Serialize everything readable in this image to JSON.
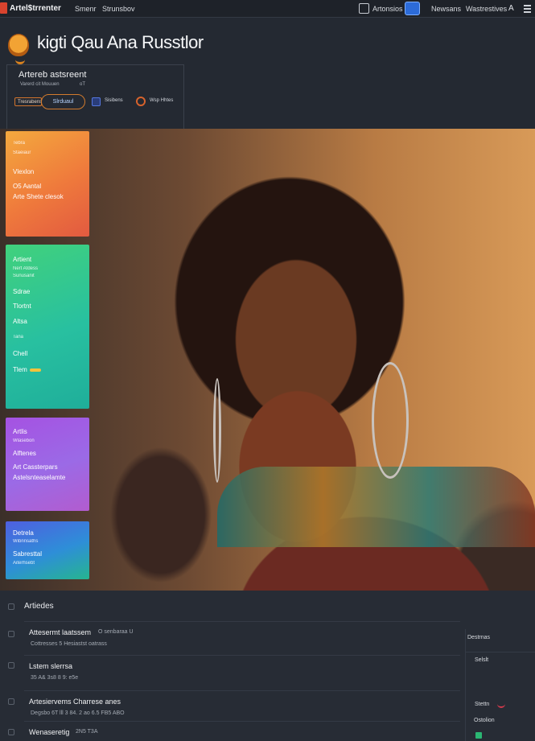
{
  "topbar": {
    "brand": "Artel$trrenter",
    "nav": [
      "Smenr",
      "Strunsbov"
    ],
    "right_items": [
      "Artonsios",
      "Newsans",
      "Wastrestives"
    ],
    "a_label": "A"
  },
  "header": {
    "site_title": "kigti Qau Ana Russtlor",
    "panel": {
      "title": "Artereb astsreent",
      "subtitle": "Varerd cit Mouuen",
      "subtitle_extra": "oT",
      "tag_a": "Tresrabens",
      "pill": "Slrduaul",
      "tag_b": "Sisibens",
      "tag_c": "Wsp Hhtes"
    }
  },
  "cards": {
    "c1": {
      "l1": "Tebra",
      "l2": "Staeiaur",
      "l3": "Vlexlon",
      "l4": "O5 Aantal",
      "l5": "Arte Shete clesok"
    },
    "c2": {
      "l1": "Artient",
      "l2": "Nert Atdess",
      "l3": "Sunusanit",
      "l4": "Sdrae",
      "l5": "Tlortnt",
      "l6": "Altsa",
      "l7": "Tana",
      "l8": "Chell",
      "l9": "Tlem"
    },
    "c3": {
      "l1": "Artlis",
      "l2": "Wlasebon",
      "l3": "Alftenes",
      "l4": "Art Cassterpars",
      "l5": "Astelsnteaselamte"
    },
    "c4": {
      "l1": "Detrela",
      "l2": "Wibnnsaths",
      "l3": "Sabresttal",
      "l4": "Aiterhsebt"
    }
  },
  "list": {
    "title": "Artiedes",
    "rows": [
      {
        "h": "Attesermt laatssem",
        "h2": "O senbaraa U",
        "m": "Cottresses    5   Hesiastst oatrass"
      },
      {
        "h": "Lstem slerrsa",
        "m": "35   A&   3s8  8   9:     e5e"
      },
      {
        "h": "Artesiervems Charrese anes",
        "m": "Degsbo   6T   lll  3   84.   2 ao   6.5  FB5   ABO"
      },
      {
        "h": "Wenaseretig",
        "h2": "2N5 T3A",
        "m": ""
      }
    ],
    "side": {
      "t1": "Destrnas",
      "t2": "Selslt",
      "t3": "Stettn",
      "t4": "Ostolion"
    }
  }
}
